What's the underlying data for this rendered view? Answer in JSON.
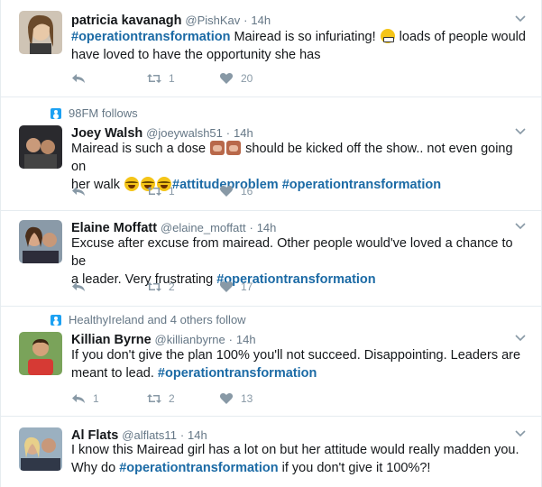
{
  "tweets": [
    {
      "context": "",
      "fullname": "patricia kavanagh",
      "handle": "@PishKav",
      "dot": "·",
      "time": "14h",
      "line1": [
        "#operationtransformation",
        " Mairead is so infuriating! ",
        "grimace-emoji",
        " loads of people would"
      ],
      "line2": "have loved to have the opportunity she has",
      "reply_count": "",
      "retweet_count": "1",
      "like_count": "20"
    },
    {
      "context": "98FM follows",
      "fullname": "Joey Walsh",
      "handle": "@joeywalsh51",
      "dot": "·",
      "time": "14h",
      "line1a": "Mairead is such a dose ",
      "line1b": " should be kicked off the show.. not even going on",
      "line2a": "her walk ",
      "line2b": "#attitudeproblem",
      "line2c": "#operationtransformation",
      "reply_count": "",
      "retweet_count": "1",
      "like_count": "16"
    },
    {
      "context": "",
      "fullname": "Elaine Moffatt",
      "handle": "@elaine_moffatt",
      "dot": "·",
      "time": "14h",
      "line1": "Excuse after excuse from mairead. Other people would've loved a chance to be",
      "line2a": "a leader. Very frustrating ",
      "line2b": "#operationtransformation",
      "reply_count": "",
      "retweet_count": "2",
      "like_count": "17"
    },
    {
      "context": "HealthyIreland and 4 others follow",
      "fullname": "Killian Byrne",
      "handle": "@killianbyrne",
      "dot": "·",
      "time": "14h",
      "line1": "If you don't give the plan 100% you'll not succeed. Disappointing. Leaders are",
      "line2a": "meant to lead. ",
      "line2b": "#operationtransformation",
      "reply_count": "1",
      "retweet_count": "2",
      "like_count": "13"
    },
    {
      "context": "",
      "fullname": "Al Flats",
      "handle": "@alflats11",
      "dot": "·",
      "time": "14h",
      "line1": "I know this Mairead girl has a lot on but her attitude would really madden you.",
      "line2a": "Why do ",
      "line2b": "#operationtransformation",
      "line2c": " if you don't give it 100%?!"
    }
  ],
  "colors": {
    "hashtag": "#1b6aa5",
    "meta": "#657786",
    "action": "#8899a6",
    "context_icon": "#1da1f2"
  },
  "icons": {
    "reply": "reply-icon",
    "retweet": "retweet-icon",
    "like": "heart-icon",
    "caret": "chevron-down-icon",
    "context": "person-follows-icon"
  }
}
